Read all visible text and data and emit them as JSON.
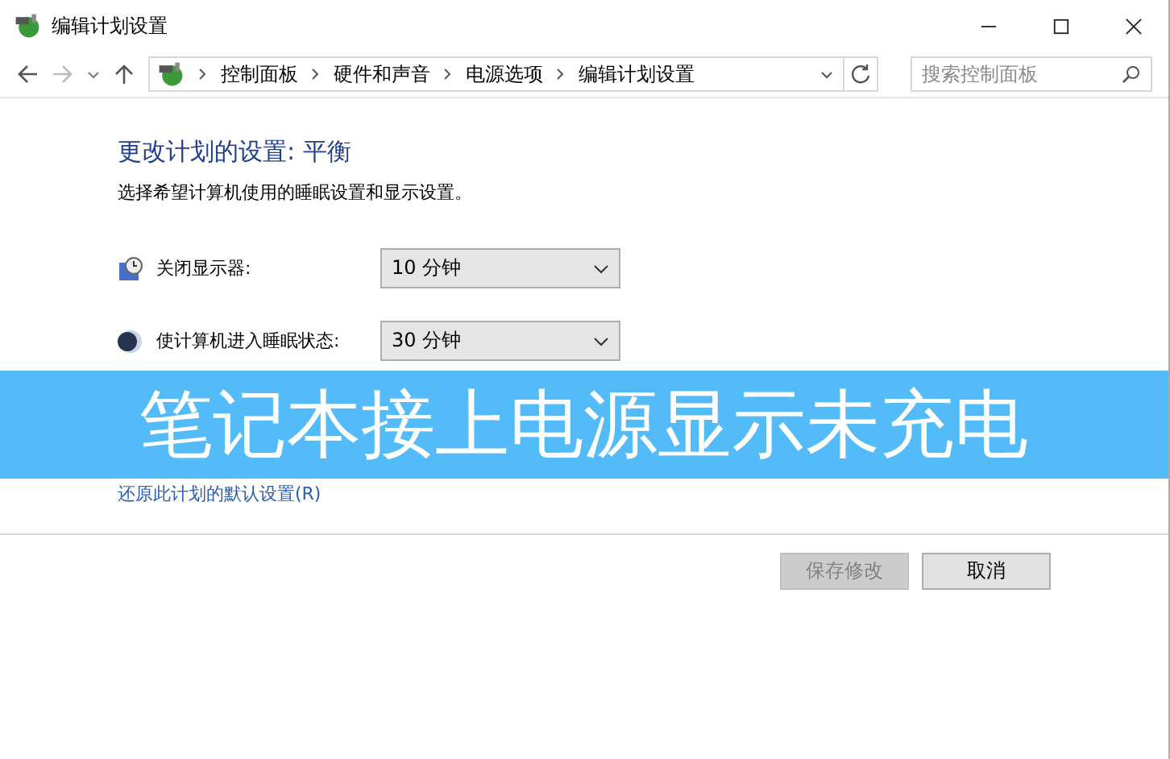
{
  "window": {
    "title": "编辑计划设置"
  },
  "breadcrumb": [
    "控制面板",
    "硬件和声音",
    "电源选项",
    "编辑计划设置"
  ],
  "search": {
    "placeholder": "搜索控制面板"
  },
  "heading": "更改计划的设置: 平衡",
  "description": "选择希望计算机使用的睡眠设置和显示设置。",
  "settings": [
    {
      "kind": "display",
      "label": "关闭显示器:",
      "value": "10 分钟"
    },
    {
      "kind": "sleep",
      "label": "使计算机进入睡眠状态:",
      "value": "30 分钟"
    }
  ],
  "banner": "笔记本接上电源显示未充电",
  "restore_link": "还原此计划的默认设置(R)",
  "buttons": [
    {
      "label": "保存修改",
      "disabled": true
    },
    {
      "label": "取消",
      "disabled": false
    }
  ]
}
